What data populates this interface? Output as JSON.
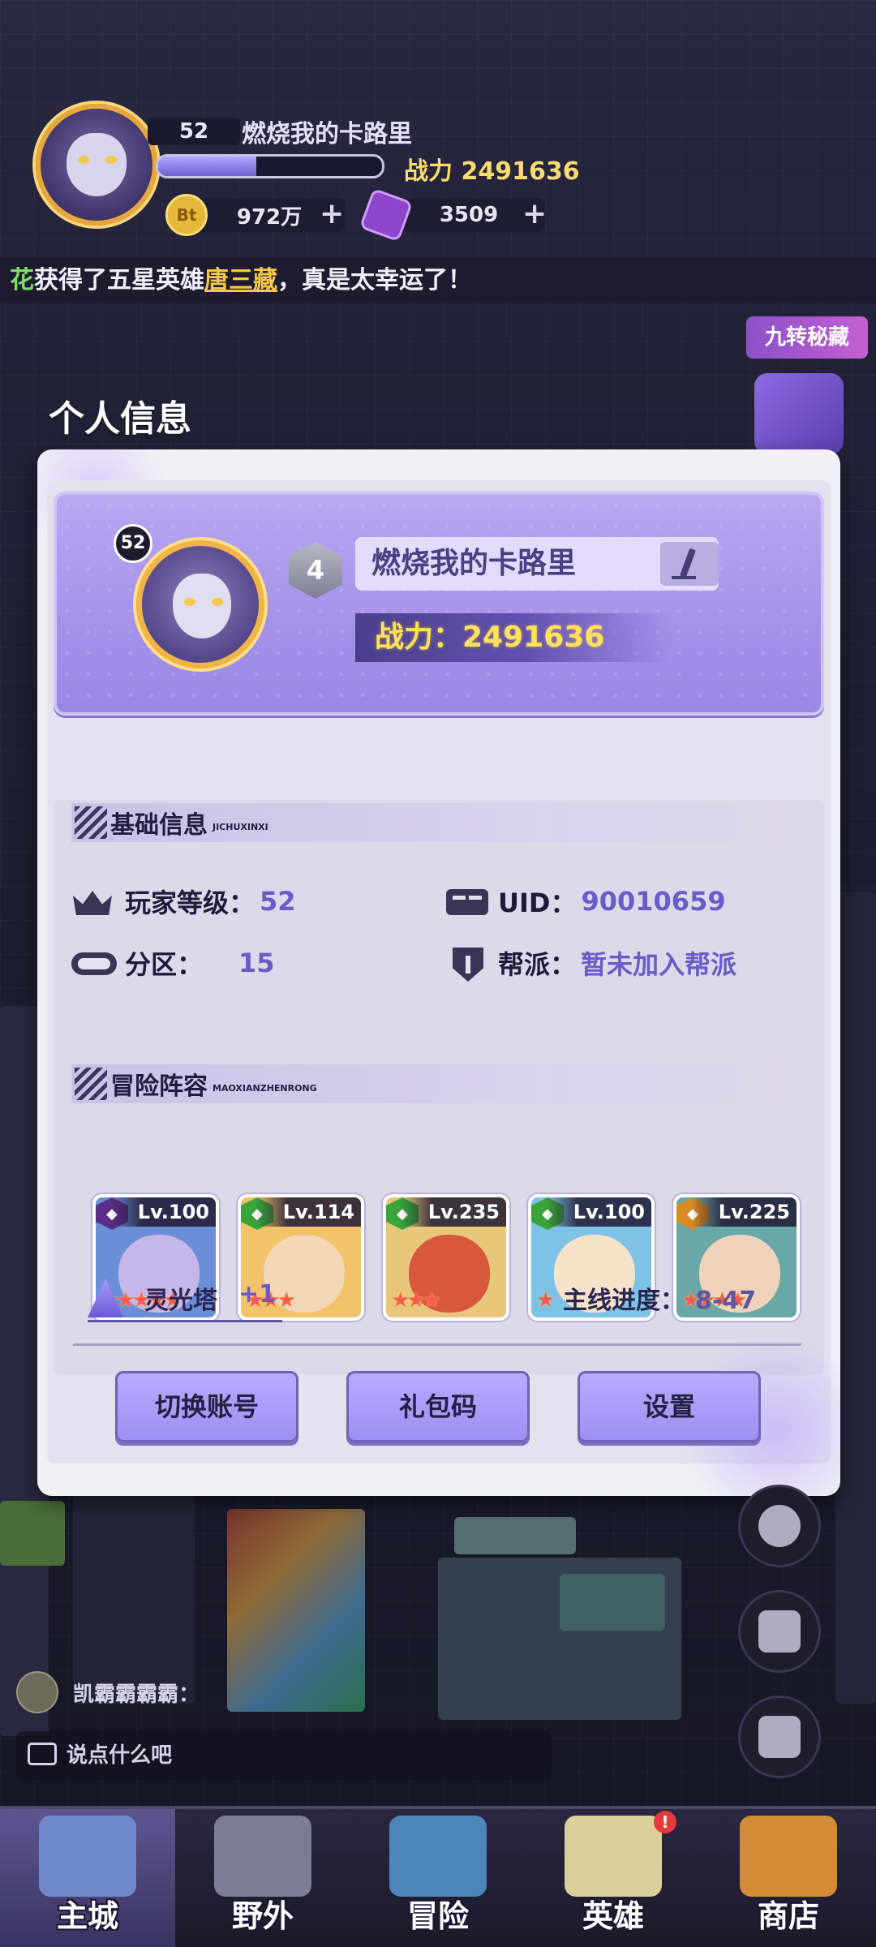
{
  "hud": {
    "level": "52",
    "player_name": "燃烧我的卡路里",
    "xp_progress": 0.44,
    "power": "战力 2491636",
    "gold": "972万",
    "gem": "3509",
    "plus": "+"
  },
  "ticker": {
    "prefix": "花",
    "text1": "获得了五星英雄",
    "hero": "唐三藏",
    "text2": "，真是太幸运了！"
  },
  "side_banner": "九转秘藏",
  "modal": {
    "title": "个人信息",
    "profile": {
      "avatar_level": "52",
      "vip": "4",
      "name": "燃烧我的卡路里",
      "power": "战力：2491636"
    },
    "basic": {
      "title": "基础信息",
      "subtitle": "JICHUXINXI",
      "player_level_label": "玩家等级：",
      "player_level": "52",
      "uid_label": "UID：",
      "uid": "90010659",
      "server_label": "分区：",
      "server": "15",
      "guild_label": "帮派：",
      "guild": "暂未加入帮派"
    },
    "lineup": {
      "title": "冒险阵容",
      "subtitle": "MAOXIANZHENRONG",
      "heroes": [
        {
          "level": "Lv.100",
          "stars": "★★★★★",
          "class_color": "#5a2e86",
          "bg": "#6b8fd6",
          "skin": "#c7b7e8"
        },
        {
          "level": "Lv.114",
          "stars": "★★★",
          "class_color": "#3aa33a",
          "bg": "#f2c36a",
          "skin": "#f3d7b6"
        },
        {
          "level": "Lv.235",
          "stars": "★★★",
          "class_color": "#3aa33a",
          "bg": "#e8c77b",
          "skin": "#d8583d"
        },
        {
          "level": "Lv.100",
          "stars": "★",
          "class_color": "#3aa33a",
          "bg": "#7ec3e7",
          "skin": "#f7e3c9"
        },
        {
          "level": "Lv.225",
          "stars": "★★★★",
          "class_color": "#d98a20",
          "bg": "#6aa7a7",
          "skin": "#f0d2bb"
        }
      ],
      "tower_label": "灵光塔",
      "tower_value": "+1",
      "progress_label": "主线进度：",
      "progress_value": "8-47"
    },
    "buttons": {
      "switch": "切换账号",
      "gift": "礼包码",
      "settings": "设置"
    }
  },
  "chat": {
    "user": "凯霸霸霸霸：",
    "placeholder": "说点什么吧"
  },
  "nav": {
    "items": [
      {
        "label": "主城",
        "color": "#6f88c9"
      },
      {
        "label": "野外",
        "color": "#7d7c96"
      },
      {
        "label": "冒险",
        "color": "#4e86b9"
      },
      {
        "label": "英雄",
        "color": "#d9cf9a"
      },
      {
        "label": "商店",
        "color": "#d48b3a"
      }
    ],
    "badge": "!"
  }
}
